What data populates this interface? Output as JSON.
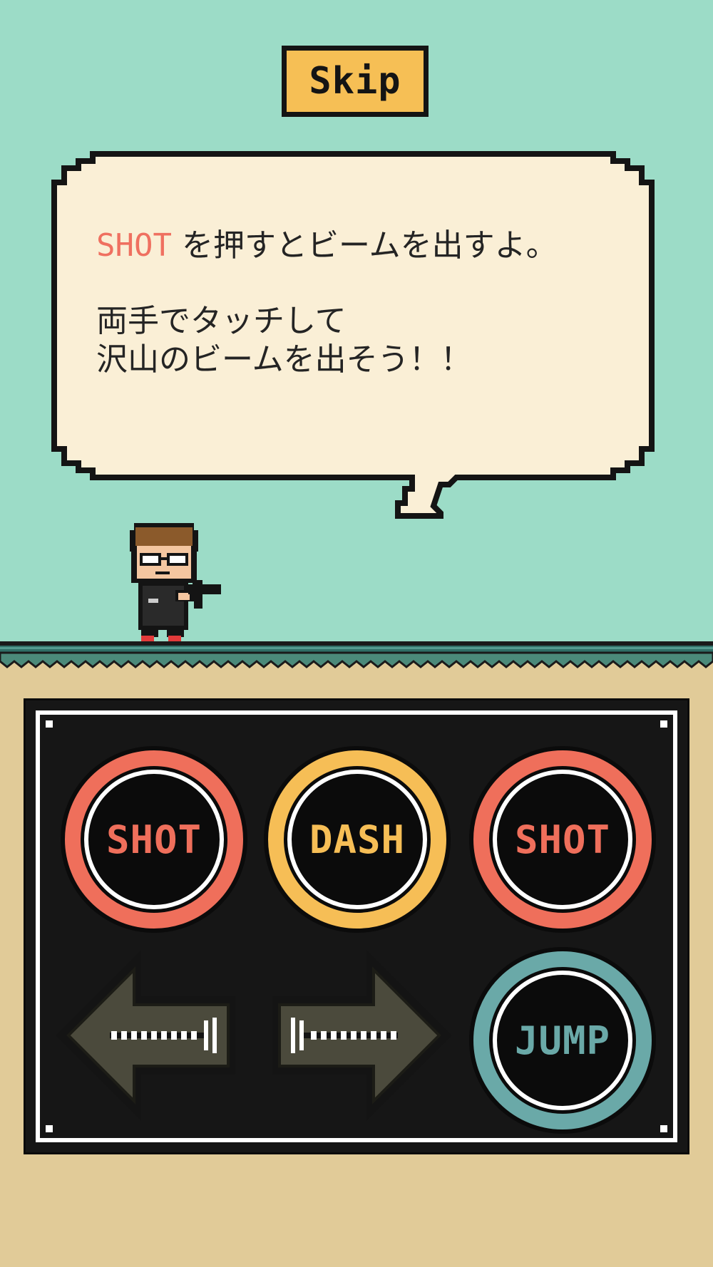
{
  "skip": {
    "label": "Skip"
  },
  "dialog": {
    "highlight": "SHOT",
    "line1_rest": " を押すとビームを出すよ。",
    "line2": "両手でタッチして",
    "line3": "沢山のビームを出そう！！"
  },
  "controls": {
    "shot_left": "SHOT",
    "dash": "DASH",
    "shot_right": "SHOT",
    "jump": "JUMP"
  },
  "icons": {
    "left": "left-arrow-icon",
    "right": "right-arrow-icon"
  },
  "colors": {
    "sky": "#9cdcc7",
    "sand": "#e1cb98",
    "shot": "#ef6f5b",
    "dash": "#f6be56",
    "jump": "#6aa9a8",
    "skip": "#f6bf55",
    "arrow": "#4a4a3d"
  }
}
